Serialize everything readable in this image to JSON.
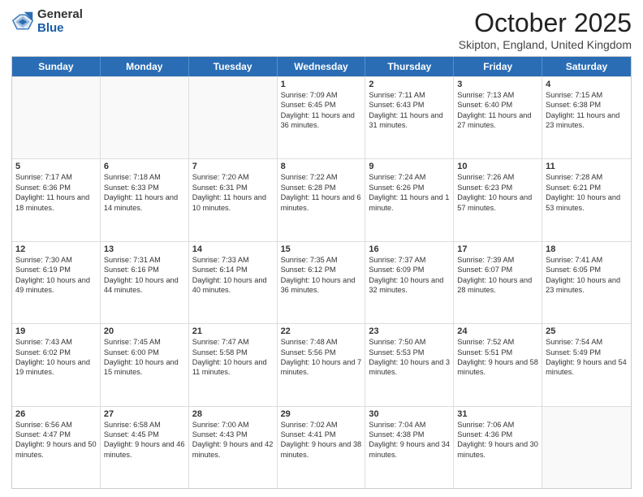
{
  "logo": {
    "general": "General",
    "blue": "Blue"
  },
  "title": "October 2025",
  "location": "Skipton, England, United Kingdom",
  "weekdays": [
    "Sunday",
    "Monday",
    "Tuesday",
    "Wednesday",
    "Thursday",
    "Friday",
    "Saturday"
  ],
  "weeks": [
    [
      {
        "day": "",
        "sunrise": "",
        "sunset": "",
        "daylight": ""
      },
      {
        "day": "",
        "sunrise": "",
        "sunset": "",
        "daylight": ""
      },
      {
        "day": "",
        "sunrise": "",
        "sunset": "",
        "daylight": ""
      },
      {
        "day": "1",
        "sunrise": "Sunrise: 7:09 AM",
        "sunset": "Sunset: 6:45 PM",
        "daylight": "Daylight: 11 hours and 36 minutes."
      },
      {
        "day": "2",
        "sunrise": "Sunrise: 7:11 AM",
        "sunset": "Sunset: 6:43 PM",
        "daylight": "Daylight: 11 hours and 31 minutes."
      },
      {
        "day": "3",
        "sunrise": "Sunrise: 7:13 AM",
        "sunset": "Sunset: 6:40 PM",
        "daylight": "Daylight: 11 hours and 27 minutes."
      },
      {
        "day": "4",
        "sunrise": "Sunrise: 7:15 AM",
        "sunset": "Sunset: 6:38 PM",
        "daylight": "Daylight: 11 hours and 23 minutes."
      }
    ],
    [
      {
        "day": "5",
        "sunrise": "Sunrise: 7:17 AM",
        "sunset": "Sunset: 6:36 PM",
        "daylight": "Daylight: 11 hours and 18 minutes."
      },
      {
        "day": "6",
        "sunrise": "Sunrise: 7:18 AM",
        "sunset": "Sunset: 6:33 PM",
        "daylight": "Daylight: 11 hours and 14 minutes."
      },
      {
        "day": "7",
        "sunrise": "Sunrise: 7:20 AM",
        "sunset": "Sunset: 6:31 PM",
        "daylight": "Daylight: 11 hours and 10 minutes."
      },
      {
        "day": "8",
        "sunrise": "Sunrise: 7:22 AM",
        "sunset": "Sunset: 6:28 PM",
        "daylight": "Daylight: 11 hours and 6 minutes."
      },
      {
        "day": "9",
        "sunrise": "Sunrise: 7:24 AM",
        "sunset": "Sunset: 6:26 PM",
        "daylight": "Daylight: 11 hours and 1 minute."
      },
      {
        "day": "10",
        "sunrise": "Sunrise: 7:26 AM",
        "sunset": "Sunset: 6:23 PM",
        "daylight": "Daylight: 10 hours and 57 minutes."
      },
      {
        "day": "11",
        "sunrise": "Sunrise: 7:28 AM",
        "sunset": "Sunset: 6:21 PM",
        "daylight": "Daylight: 10 hours and 53 minutes."
      }
    ],
    [
      {
        "day": "12",
        "sunrise": "Sunrise: 7:30 AM",
        "sunset": "Sunset: 6:19 PM",
        "daylight": "Daylight: 10 hours and 49 minutes."
      },
      {
        "day": "13",
        "sunrise": "Sunrise: 7:31 AM",
        "sunset": "Sunset: 6:16 PM",
        "daylight": "Daylight: 10 hours and 44 minutes."
      },
      {
        "day": "14",
        "sunrise": "Sunrise: 7:33 AM",
        "sunset": "Sunset: 6:14 PM",
        "daylight": "Daylight: 10 hours and 40 minutes."
      },
      {
        "day": "15",
        "sunrise": "Sunrise: 7:35 AM",
        "sunset": "Sunset: 6:12 PM",
        "daylight": "Daylight: 10 hours and 36 minutes."
      },
      {
        "day": "16",
        "sunrise": "Sunrise: 7:37 AM",
        "sunset": "Sunset: 6:09 PM",
        "daylight": "Daylight: 10 hours and 32 minutes."
      },
      {
        "day": "17",
        "sunrise": "Sunrise: 7:39 AM",
        "sunset": "Sunset: 6:07 PM",
        "daylight": "Daylight: 10 hours and 28 minutes."
      },
      {
        "day": "18",
        "sunrise": "Sunrise: 7:41 AM",
        "sunset": "Sunset: 6:05 PM",
        "daylight": "Daylight: 10 hours and 23 minutes."
      }
    ],
    [
      {
        "day": "19",
        "sunrise": "Sunrise: 7:43 AM",
        "sunset": "Sunset: 6:02 PM",
        "daylight": "Daylight: 10 hours and 19 minutes."
      },
      {
        "day": "20",
        "sunrise": "Sunrise: 7:45 AM",
        "sunset": "Sunset: 6:00 PM",
        "daylight": "Daylight: 10 hours and 15 minutes."
      },
      {
        "day": "21",
        "sunrise": "Sunrise: 7:47 AM",
        "sunset": "Sunset: 5:58 PM",
        "daylight": "Daylight: 10 hours and 11 minutes."
      },
      {
        "day": "22",
        "sunrise": "Sunrise: 7:48 AM",
        "sunset": "Sunset: 5:56 PM",
        "daylight": "Daylight: 10 hours and 7 minutes."
      },
      {
        "day": "23",
        "sunrise": "Sunrise: 7:50 AM",
        "sunset": "Sunset: 5:53 PM",
        "daylight": "Daylight: 10 hours and 3 minutes."
      },
      {
        "day": "24",
        "sunrise": "Sunrise: 7:52 AM",
        "sunset": "Sunset: 5:51 PM",
        "daylight": "Daylight: 9 hours and 58 minutes."
      },
      {
        "day": "25",
        "sunrise": "Sunrise: 7:54 AM",
        "sunset": "Sunset: 5:49 PM",
        "daylight": "Daylight: 9 hours and 54 minutes."
      }
    ],
    [
      {
        "day": "26",
        "sunrise": "Sunrise: 6:56 AM",
        "sunset": "Sunset: 4:47 PM",
        "daylight": "Daylight: 9 hours and 50 minutes."
      },
      {
        "day": "27",
        "sunrise": "Sunrise: 6:58 AM",
        "sunset": "Sunset: 4:45 PM",
        "daylight": "Daylight: 9 hours and 46 minutes."
      },
      {
        "day": "28",
        "sunrise": "Sunrise: 7:00 AM",
        "sunset": "Sunset: 4:43 PM",
        "daylight": "Daylight: 9 hours and 42 minutes."
      },
      {
        "day": "29",
        "sunrise": "Sunrise: 7:02 AM",
        "sunset": "Sunset: 4:41 PM",
        "daylight": "Daylight: 9 hours and 38 minutes."
      },
      {
        "day": "30",
        "sunrise": "Sunrise: 7:04 AM",
        "sunset": "Sunset: 4:38 PM",
        "daylight": "Daylight: 9 hours and 34 minutes."
      },
      {
        "day": "31",
        "sunrise": "Sunrise: 7:06 AM",
        "sunset": "Sunset: 4:36 PM",
        "daylight": "Daylight: 9 hours and 30 minutes."
      },
      {
        "day": "",
        "sunrise": "",
        "sunset": "",
        "daylight": ""
      }
    ]
  ]
}
